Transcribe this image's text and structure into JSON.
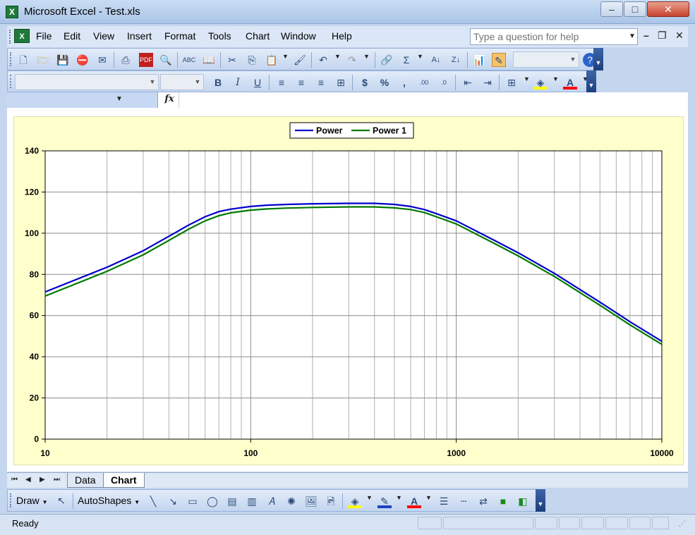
{
  "window": {
    "title": "Microsoft Excel - Test.xls",
    "app_icon": "X",
    "minimize": "–",
    "maximize": "□",
    "close": "✕"
  },
  "menu": {
    "items": [
      "File",
      "Edit",
      "View",
      "Insert",
      "Format",
      "Tools",
      "Chart",
      "Window",
      "Help"
    ],
    "help_placeholder": "Type a question for help"
  },
  "formula_bar": {
    "fx": "fx"
  },
  "sheet_tabs": {
    "tabs": [
      "Data",
      "Chart"
    ],
    "active": "Chart"
  },
  "drawing_toolbar": {
    "draw_label": "Draw",
    "autoshapes_label": "AutoShapes"
  },
  "status": {
    "text": "Ready"
  },
  "colors": {
    "plot_background": "#ffffcc",
    "series_power": "#0000cc",
    "series_power_1": "#007a00"
  },
  "icons": {
    "standard_toolbar": [
      "new-icon",
      "open-icon",
      "save-icon",
      "permission-icon",
      "email-icon",
      "print-icon",
      "research-icon",
      "print-preview-icon",
      "spelling-icon",
      "research-book-icon",
      "cut-icon",
      "copy-icon",
      "paste-icon",
      "format-painter-icon",
      "undo-icon",
      "redo-icon",
      "hyperlink-icon",
      "autosum-icon",
      "sort-ascending-icon",
      "sort-descending-icon",
      "chart-wizard-icon",
      "drawing-icon",
      "help-icon"
    ],
    "formatting_toolbar": [
      "bold-icon",
      "italic-icon",
      "underline-icon",
      "align-left-icon",
      "center-icon",
      "align-right-icon",
      "merge-center-icon",
      "currency-icon",
      "percent-icon",
      "comma-icon",
      "increase-decimal-icon",
      "decrease-decimal-icon",
      "decrease-indent-icon",
      "increase-indent-icon",
      "borders-icon",
      "fill-color-icon",
      "font-color-icon"
    ]
  },
  "chart_data": {
    "type": "line",
    "x_scale": "log",
    "xlim": [
      10,
      10000
    ],
    "ylim": [
      0,
      140
    ],
    "x_ticks": [
      "10",
      "100",
      "1000",
      "10000"
    ],
    "y_ticks": [
      "0",
      "20",
      "40",
      "60",
      "80",
      "100",
      "120",
      "140"
    ],
    "grid": true,
    "legend_position": "top-center",
    "series": [
      {
        "name": "Power",
        "color": "#0000cc",
        "points": [
          [
            10,
            71.5
          ],
          [
            20,
            83.5
          ],
          [
            30,
            91.5
          ],
          [
            40,
            98.5
          ],
          [
            50,
            104
          ],
          [
            60,
            108
          ],
          [
            70,
            110.5
          ],
          [
            80,
            111.7
          ],
          [
            100,
            113
          ],
          [
            120,
            113.6
          ],
          [
            150,
            114
          ],
          [
            200,
            114.3
          ],
          [
            300,
            114.5
          ],
          [
            400,
            114.5
          ],
          [
            500,
            114
          ],
          [
            600,
            113
          ],
          [
            700,
            111.5
          ],
          [
            800,
            109.5
          ],
          [
            1000,
            106
          ],
          [
            1500,
            97
          ],
          [
            2000,
            90.5
          ],
          [
            3000,
            80.5
          ],
          [
            5000,
            66.5
          ],
          [
            7000,
            57
          ],
          [
            10000,
            47.5
          ]
        ]
      },
      {
        "name": "Power 1",
        "color": "#007a00",
        "points": [
          [
            10,
            69.5
          ],
          [
            20,
            81.5
          ],
          [
            30,
            89.5
          ],
          [
            40,
            96.5
          ],
          [
            50,
            102
          ],
          [
            60,
            106
          ],
          [
            70,
            108.5
          ],
          [
            80,
            109.9
          ],
          [
            100,
            111.2
          ],
          [
            120,
            111.8
          ],
          [
            150,
            112.2
          ],
          [
            200,
            112.5
          ],
          [
            300,
            112.8
          ],
          [
            400,
            112.8
          ],
          [
            500,
            112.3
          ],
          [
            600,
            111.5
          ],
          [
            700,
            110
          ],
          [
            800,
            108
          ],
          [
            1000,
            104.5
          ],
          [
            1500,
            95.5
          ],
          [
            2000,
            89
          ],
          [
            3000,
            79
          ],
          [
            5000,
            65
          ],
          [
            7000,
            55.5
          ],
          [
            10000,
            46
          ]
        ]
      }
    ]
  }
}
